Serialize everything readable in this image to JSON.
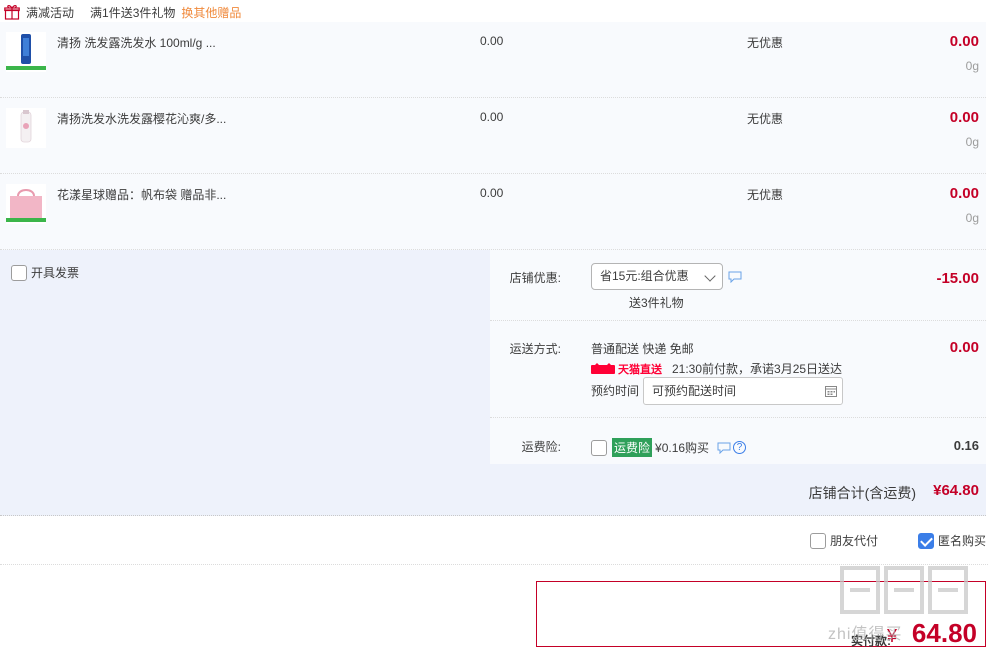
{
  "promo": {
    "tag": "满减活动",
    "rule": "满1件送3件礼物",
    "change_link": "换其他赠品"
  },
  "items": [
    {
      "name": "清扬 洗发露洗发水 100ml/g ...",
      "price": "0.00",
      "discount": "无优惠",
      "subtotal": "0.00",
      "weight": "0g",
      "thumb_color": "#1f4fa8"
    },
    {
      "name": "清扬洗发水洗发露樱花沁爽/多...",
      "price": "0.00",
      "discount": "无优惠",
      "subtotal": "0.00",
      "weight": "0g",
      "thumb_color": "#e9a3b8"
    },
    {
      "name": "花漾星球赠品：帆布袋 赠品非...",
      "price": "0.00",
      "discount": "无优惠",
      "subtotal": "0.00",
      "weight": "0g",
      "thumb_color": "#f2b6c6"
    }
  ],
  "invoice": {
    "label": "开具发票",
    "checked": false
  },
  "coupon": {
    "label": "店铺优惠:",
    "selected": "省15元:组合优惠",
    "note": "送3件礼物",
    "amount": "-15.00"
  },
  "shipping": {
    "label": "运送方式:",
    "method": "普通配送 快递 免邮",
    "tmall_badge": "天猫直送",
    "promise": "21:30前付款，承诺3月25日送达",
    "schedule_label": "预约时间",
    "schedule_value": "可预约配送时间",
    "amount": "0.00"
  },
  "insurance": {
    "label": "运费险:",
    "badge": "运费险",
    "price_text": "¥0.16购买",
    "amount": "0.16",
    "checked": false
  },
  "store_total": {
    "label": "店铺合计(含运费)",
    "value": "¥64.80"
  },
  "options": {
    "friend_pay": {
      "label": "朋友代付",
      "checked": false
    },
    "anonymous": {
      "label": "匿名购买",
      "checked": true
    }
  },
  "payment": {
    "label": "实付款:",
    "currency": "¥",
    "value": "64.80"
  },
  "watermark": {
    "text": "zhi值得买"
  },
  "colors": {
    "price_red": "#c40027",
    "accent_blue": "#3b7ee8",
    "link_orange": "#f08a3c",
    "tmall_red": "#ff0036",
    "insurance_green": "#2fa05a",
    "panel_bg": "#eef2fb"
  }
}
